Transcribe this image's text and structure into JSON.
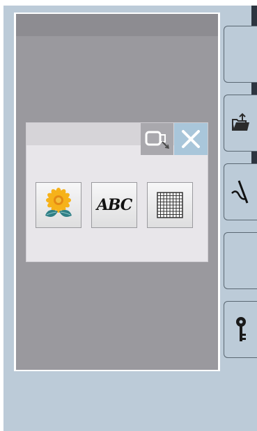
{
  "dialog": {
    "pattern_button": {
      "icon": "flower-icon"
    },
    "character_button": {
      "label": "ABC"
    },
    "grid_button": {
      "icon": "grid-icon"
    },
    "hoop_button": {
      "icon": "embroidery-hoop-icon"
    },
    "close_button": {
      "icon": "close-icon"
    }
  },
  "sidebar": {
    "buttons": [
      {
        "icon": ""
      },
      {
        "icon": "folder-upload-icon"
      },
      {
        "icon": "needle-thread-icon"
      },
      {
        "icon": ""
      },
      {
        "icon": "key-icon"
      }
    ]
  },
  "colors": {
    "frame": "#bccbd8",
    "screen": "#9a999e",
    "dialog": "#e8e6ea",
    "close_accent": "#a9c6da"
  }
}
